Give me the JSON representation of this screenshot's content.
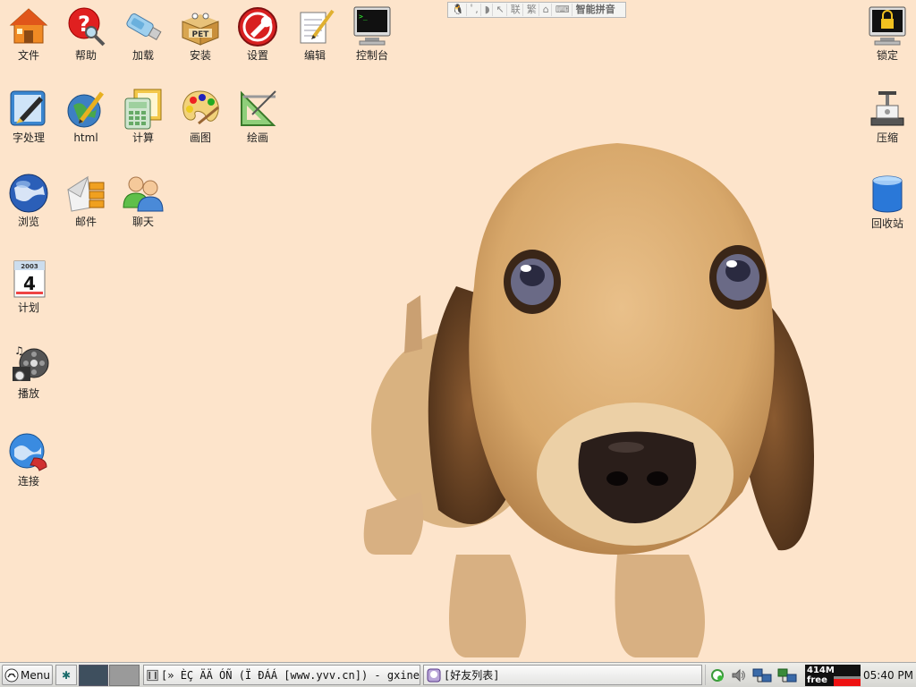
{
  "desktop": {
    "icons": [
      {
        "label": "文件",
        "icon": "home-folder-icon"
      },
      {
        "label": "帮助",
        "icon": "help-icon"
      },
      {
        "label": "加载",
        "icon": "usb-drive-icon"
      },
      {
        "label": "安装",
        "icon": "pet-package-icon"
      },
      {
        "label": "设置",
        "icon": "settings-icon"
      },
      {
        "label": "编辑",
        "icon": "notepad-icon"
      },
      {
        "label": "控制台",
        "icon": "terminal-icon"
      },
      {
        "label": "字处理",
        "icon": "word-processor-icon"
      },
      {
        "label": "html",
        "icon": "html-editor-icon"
      },
      {
        "label": "计算",
        "icon": "spreadsheet-icon"
      },
      {
        "label": "画图",
        "icon": "paint-palette-icon"
      },
      {
        "label": "绘画",
        "icon": "draw-icon"
      },
      {
        "label": "浏览",
        "icon": "browser-globe-icon"
      },
      {
        "label": "邮件",
        "icon": "mail-icon"
      },
      {
        "label": "聊天",
        "icon": "chat-icon"
      },
      {
        "label": "计划",
        "icon": "calendar-icon"
      },
      {
        "label": "播放",
        "icon": "media-player-icon"
      },
      {
        "label": "连接",
        "icon": "connect-icon"
      },
      {
        "label": "锁定",
        "icon": "lock-screen-icon"
      },
      {
        "label": "压缩",
        "icon": "compress-icon"
      },
      {
        "label": "回收站",
        "icon": "trash-icon"
      }
    ],
    "calendar_year": "2003",
    "calendar_day": "4",
    "pet_text": "PET"
  },
  "ime": {
    "items": [
      "联",
      "繁"
    ],
    "name": "智能拼音"
  },
  "taskbar": {
    "menu_label": "Menu",
    "tasks": [
      {
        "label": "[» ÈÇ ÄÄ ÓÑ (Ï ÐÁÁ [www.yvv.cn]) - gxine",
        "icon": "video-window-icon"
      },
      {
        "label": "[好友列表]",
        "icon": "chat-window-icon"
      }
    ],
    "memory": "414M",
    "memory_unit": "free",
    "clock": "05:40 PM"
  },
  "colors": {
    "desktop_bg": "#fde4cb",
    "taskbar_bg": "#e2e2de",
    "memory_bar": "#e11111"
  }
}
